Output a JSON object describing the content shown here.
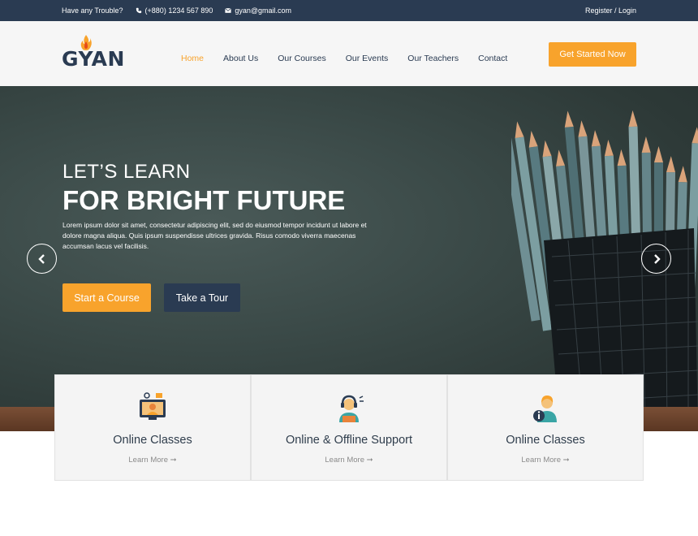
{
  "topbar": {
    "trouble": "Have any Trouble?",
    "phone": "(+880) 1234 567 890",
    "email": "gyan@gmail.com",
    "auth": "Register / Login"
  },
  "header": {
    "logo": "GYAN",
    "nav": [
      "Home",
      "About Us",
      "Our Courses",
      "Our Events",
      "Our Teachers",
      "Contact"
    ],
    "active": "Home",
    "cta": "Get Started Now"
  },
  "hero": {
    "subtitle": "LET’S LEARN",
    "title": "FOR BRIGHT FUTURE",
    "text": "Lorem ipsum dolor sit amet, consectetur adipiscing elit, sed do eiusmod tempor incidunt ut labore et dolore magna aliqua. Quis ipsum suspendisse ultrices gravida. Risus comodo viverra maecenas accumsan lacus vel facilisis.",
    "btn_course": "Start a Course",
    "btn_tour": "Take a Tour"
  },
  "features": [
    {
      "title": "Online Classes",
      "link": "Learn More",
      "icon": "online-class-icon"
    },
    {
      "title": "Online & Offline Support",
      "link": "Learn More",
      "icon": "support-agent-icon"
    },
    {
      "title": "Online Classes",
      "link": "Learn More",
      "icon": "info-person-icon"
    }
  ],
  "colors": {
    "accent": "#f8a32c",
    "navy": "#2a3b52"
  }
}
